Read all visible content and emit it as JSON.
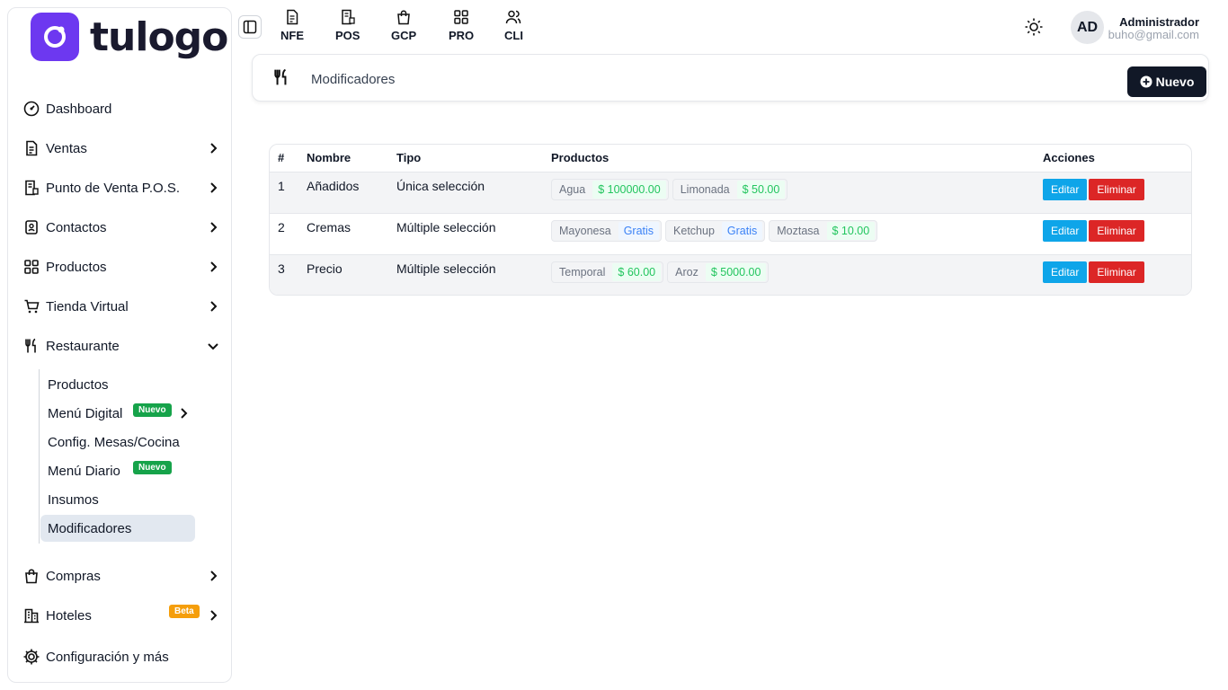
{
  "brand": {
    "name": "tulogo",
    "accent": "#6d38f0"
  },
  "sidebar": {
    "items": [
      {
        "label": "Dashboard",
        "icon": "gauge-icon"
      },
      {
        "label": "Ventas",
        "icon": "document-icon"
      },
      {
        "label": "Punto de Venta P.O.S.",
        "icon": "pos-icon"
      },
      {
        "label": "Contactos",
        "icon": "contacts-icon"
      },
      {
        "label": "Productos",
        "icon": "grid-icon"
      },
      {
        "label": "Tienda Virtual",
        "icon": "cart-icon"
      },
      {
        "label": "Restaurante",
        "icon": "utensils-icon"
      },
      {
        "label": "Compras",
        "icon": "bag-icon"
      },
      {
        "label": "Hoteles",
        "icon": "building-icon",
        "badge": "Beta"
      },
      {
        "label": "Configuración y más",
        "icon": "gear-icon"
      }
    ],
    "restaurant_sub": [
      {
        "label": "Productos"
      },
      {
        "label": "Menú Digital",
        "badge": "Nuevo"
      },
      {
        "label": "Config. Mesas/Cocina"
      },
      {
        "label": "Menú Diario",
        "badge": "Nuevo"
      },
      {
        "label": "Insumos"
      },
      {
        "label": "Modificadores",
        "active": true
      }
    ]
  },
  "topnav": [
    {
      "label": "NFE",
      "icon": "file-icon"
    },
    {
      "label": "POS",
      "icon": "receipt-icon"
    },
    {
      "label": "GCP",
      "icon": "shopping-bag-icon"
    },
    {
      "label": "PRO",
      "icon": "grid-icon"
    },
    {
      "label": "CLI",
      "icon": "users-icon"
    }
  ],
  "user": {
    "initials": "AD",
    "name": "Administrador",
    "email": "buho@gmail.com"
  },
  "page": {
    "title": "Modificadores",
    "new_label": "Nuevo"
  },
  "table": {
    "headers": [
      "#",
      "Nombre",
      "Tipo",
      "Productos",
      "Acciones"
    ],
    "edit_label": "Editar",
    "delete_label": "Eliminar",
    "rows": [
      {
        "num": "1",
        "name": "Añadidos",
        "type": "Única selección",
        "products": [
          {
            "name": "Agua",
            "price": "$ 100000.00"
          },
          {
            "name": "Limonada",
            "price": "$ 50.00"
          }
        ]
      },
      {
        "num": "2",
        "name": "Cremas",
        "type": "Múltiple selección",
        "products": [
          {
            "name": "Mayonesa",
            "price": "Gratis"
          },
          {
            "name": "Ketchup",
            "price": "Gratis"
          },
          {
            "name": "Moztasa",
            "price": "$ 10.00"
          }
        ]
      },
      {
        "num": "3",
        "name": "Precio",
        "type": "Múltiple selección",
        "products": [
          {
            "name": "Temporal",
            "price": "$ 60.00"
          },
          {
            "name": "Aroz",
            "price": "$ 5000.00"
          }
        ]
      }
    ]
  }
}
